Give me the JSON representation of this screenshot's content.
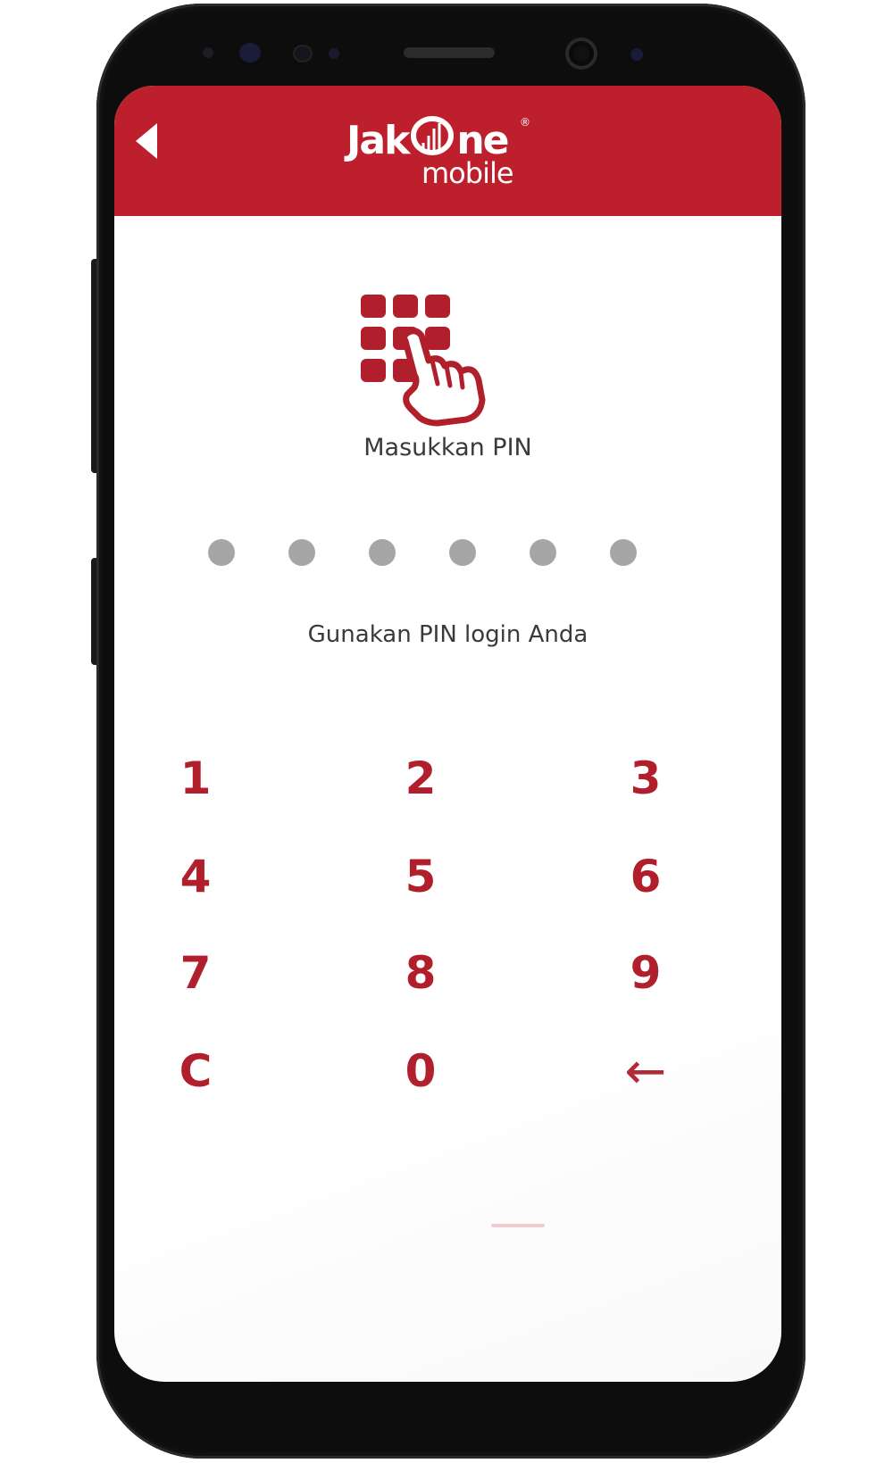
{
  "header": {
    "logo_text_main": "JakOne",
    "logo_text_sub": "mobile",
    "logo_registered": "®",
    "background_color": "#bd1f2c"
  },
  "icons": {
    "back": "back-arrow-icon",
    "keypad": "keypad-touch-icon",
    "backspace": "backspace-arrow-icon"
  },
  "pin": {
    "title": "Masukkan PIN",
    "hint": "Gunakan PIN login Anda",
    "length": 6,
    "filled": 0,
    "dot_color": "#a6a6a6"
  },
  "keypad": {
    "keys": [
      "1",
      "2",
      "3",
      "4",
      "5",
      "6",
      "7",
      "8",
      "9",
      "C",
      "0",
      "←"
    ],
    "key_color": "#b01f2b"
  }
}
